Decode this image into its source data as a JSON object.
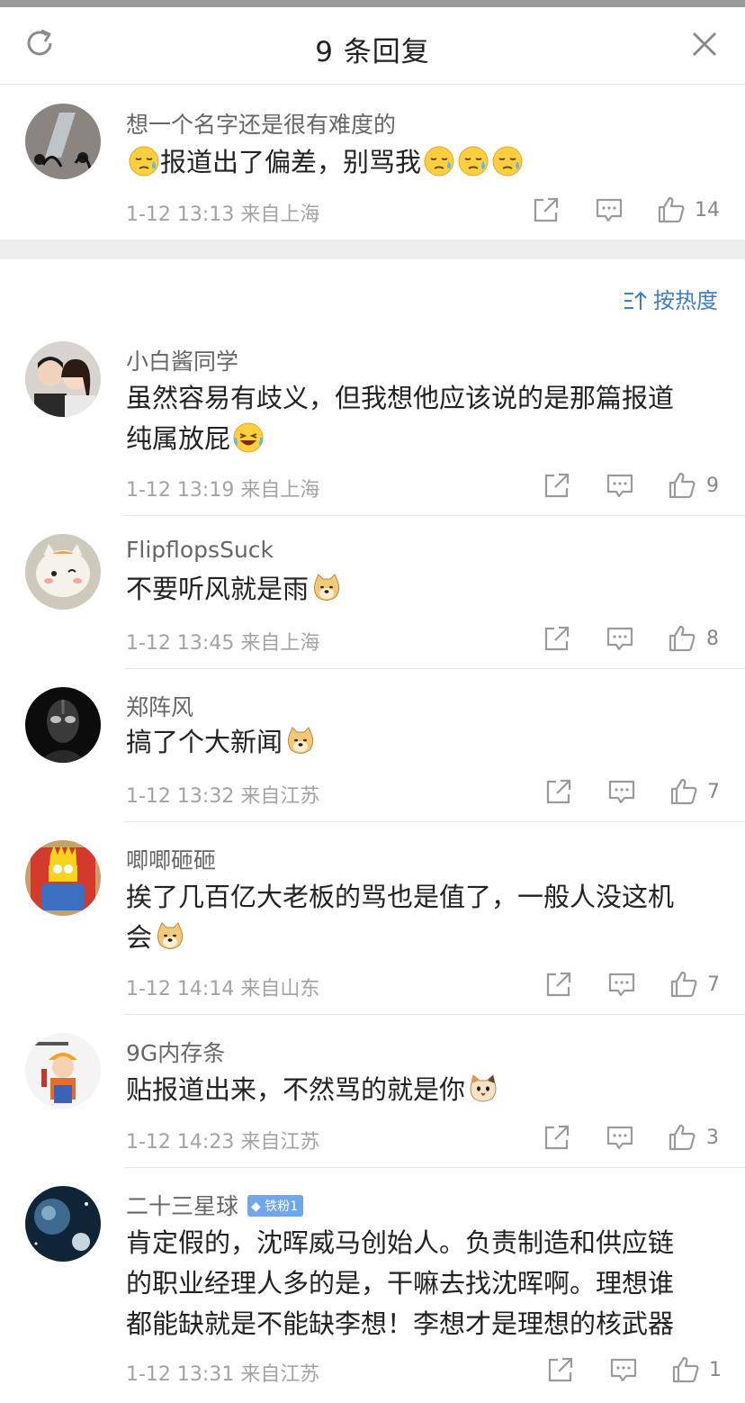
{
  "header": {
    "title": "9 条回复"
  },
  "original": {
    "author": "想一个名字还是很有难度的",
    "text": "报道出了偏差，别骂我",
    "time": "1-12 13:13",
    "location": "来自上海",
    "likes": "14"
  },
  "sort": {
    "label": "按热度"
  },
  "replies": [
    {
      "author": "小白酱同学",
      "text_line1": "虽然容易有歧义，但我想他应该说的是那篇报道",
      "text_line2": "纯属放屁",
      "time": "1-12 13:19",
      "location": "来自上海",
      "likes": "9"
    },
    {
      "author": "FlipflopsSuck",
      "text": "不要听风就是雨",
      "time": "1-12 13:45",
      "location": "来自上海",
      "likes": "8"
    },
    {
      "author": "郑阵风",
      "text": "搞了个大新闻",
      "time": "1-12 13:32",
      "location": "来自江苏",
      "likes": "7"
    },
    {
      "author": "唧唧砸砸",
      "text_line1": "挨了几百亿大老板的骂也是值了，一般人没这机",
      "text_line2": "会",
      "time": "1-12 14:14",
      "location": "来自山东",
      "likes": "7"
    },
    {
      "author": "9G内存条",
      "text": "贴报道出来，不然骂的就是你",
      "time": "1-12 14:23",
      "location": "来自江苏",
      "likes": "3"
    },
    {
      "author": "二十三星球",
      "badge": "铁粉1",
      "text_line1": "肯定假的，沈晖威马创始人。负责制造和供应链",
      "text_line2": "的职业经理人多的是，干嘛去找沈晖啊。理想谁",
      "text_line3": "都能缺就是不能缺李想！李想才是理想的核武器",
      "time": "1-12 13:31",
      "location": "来自江苏",
      "likes": "1"
    }
  ],
  "icons": [
    "refresh-icon",
    "close-icon",
    "share-icon",
    "comment-icon",
    "like-icon",
    "sort-icon",
    "sweat-emoji",
    "laugh-emoji",
    "doge-emoji",
    "cat-emoji"
  ]
}
